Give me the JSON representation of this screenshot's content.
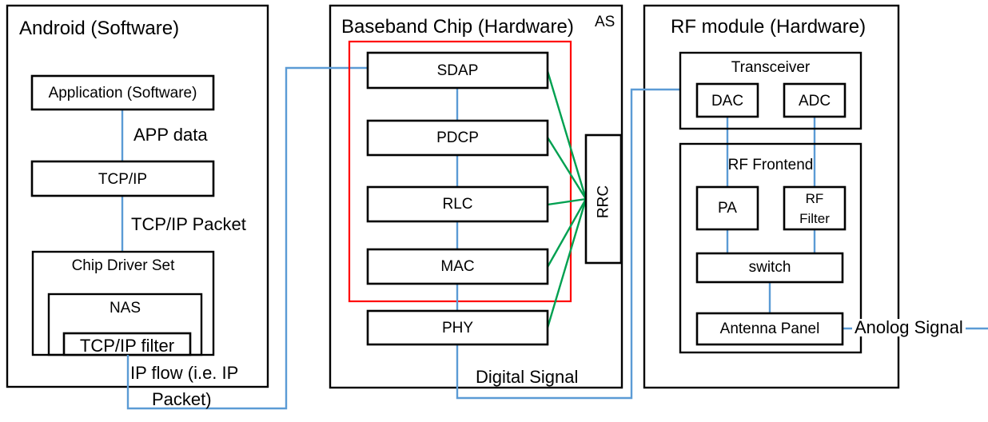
{
  "diagram": {
    "title_hidden": "",
    "panels": [
      {
        "id": "android",
        "title": "Android (Software)",
        "boxes": [
          {
            "id": "application",
            "label": "Application (Software)"
          },
          {
            "id": "tcpip",
            "label": "TCP/IP"
          },
          {
            "id": "chip-driver-set",
            "label": "Chip Driver Set"
          },
          {
            "id": "nas",
            "label": "NAS"
          },
          {
            "id": "tcpip-filter",
            "label": "TCP/IP filter"
          }
        ],
        "flow_labels": [
          {
            "id": "app-data",
            "label": "APP data"
          },
          {
            "id": "tcpip-packet",
            "label": "TCP/IP Packet"
          },
          {
            "id": "ip-flow-line1",
            "label": "IP flow (i.e. IP"
          },
          {
            "id": "ip-flow-line2",
            "label": "Packet)"
          }
        ]
      },
      {
        "id": "baseband",
        "title": "Baseband Chip (Hardware)",
        "corner_label": "AS",
        "boxes": [
          {
            "id": "sdap",
            "label": "SDAP"
          },
          {
            "id": "pdcp",
            "label": "PDCP"
          },
          {
            "id": "rlc",
            "label": "RLC"
          },
          {
            "id": "mac",
            "label": "MAC"
          },
          {
            "id": "phy",
            "label": "PHY"
          },
          {
            "id": "rrc",
            "label": "RRC"
          }
        ],
        "flow_labels": [
          {
            "id": "digital-signal",
            "label": "Digital Signal"
          }
        ]
      },
      {
        "id": "rf-module",
        "title": "RF module (Hardware)",
        "boxes": [
          {
            "id": "transceiver",
            "label": "Transceiver"
          },
          {
            "id": "dac",
            "label": "DAC"
          },
          {
            "id": "adc",
            "label": "ADC"
          },
          {
            "id": "rf-frontend",
            "label": "RF Frontend"
          },
          {
            "id": "pa",
            "label": "PA"
          },
          {
            "id": "rf-filter-line1",
            "label": "RF"
          },
          {
            "id": "rf-filter-line2",
            "label": "Filter"
          },
          {
            "id": "switch",
            "label": "switch"
          },
          {
            "id": "antenna-panel",
            "label": "Antenna Panel"
          }
        ],
        "flow_labels": [
          {
            "id": "analog-signal",
            "label": "Anolog Signal"
          }
        ]
      }
    ],
    "colors": {
      "connector_blue": "#5b9bd5",
      "connector_green": "#00a050",
      "highlight_red": "#ff0000",
      "outline_black": "#000000",
      "background": "#ffffff"
    }
  }
}
